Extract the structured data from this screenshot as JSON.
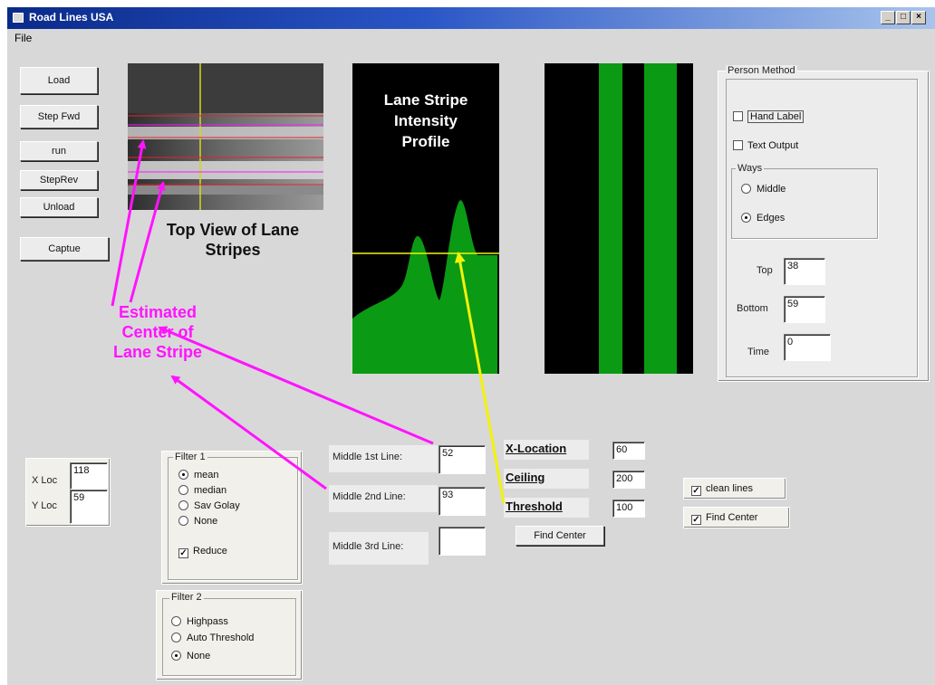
{
  "window": {
    "title": "Road Lines USA",
    "minimize": "_",
    "maximize": "□",
    "close": "×"
  },
  "menu": {
    "file": "File"
  },
  "buttons": {
    "load": "Load",
    "step_fwd": "Step Fwd",
    "run": "run",
    "step_rev": "StepRev",
    "unload": "Unload",
    "capture": "Captue",
    "find_center": "Find Center"
  },
  "panels": {
    "top_view_label": "Top View of Lane Stripes",
    "profile_title": [
      "Lane Stripe",
      "Intensity",
      "Profile"
    ]
  },
  "annotation": {
    "estimated_center": [
      "Estimated",
      "Center of",
      "Lane Stripe"
    ]
  },
  "person_method": {
    "legend": "Person Method",
    "hand_label": "Hand Label",
    "hand_label_checked": false,
    "text_output": "Text Output",
    "text_output_checked": false,
    "ways_legend": "Ways",
    "middle": "Middle",
    "edges": "Edges",
    "ways_selected": "edges",
    "top_label": "Top",
    "top_value": "38",
    "bottom_label": "Bottom",
    "bottom_value": "59",
    "time_label": "Time",
    "time_value": "0"
  },
  "loc": {
    "x_label": "X Loc",
    "x_value": "118",
    "y_label": "Y Loc",
    "y_value": "59"
  },
  "filter1": {
    "legend": "Filter 1",
    "options": [
      "mean",
      "median",
      "Sav Golay",
      "None"
    ],
    "selected": 0,
    "reduce": "Reduce",
    "reduce_checked": true
  },
  "filter2": {
    "legend": "Filter 2",
    "options": [
      "Highpass",
      "Auto Threshold",
      "None"
    ],
    "selected": 2
  },
  "middles": {
    "line1_label": "Middle 1st Line:",
    "line1_value": "52",
    "line2_label": "Middle 2nd Line:",
    "line2_value": "93",
    "line3_label": "Middle 3rd Line:",
    "line3_value": ""
  },
  "params": {
    "xloc_label": "X-Location",
    "xloc_value": "60",
    "ceiling_label": "Ceiling",
    "ceiling_value": "200",
    "threshold_label": "Threshold",
    "threshold_value": "100"
  },
  "options": {
    "clean_lines": "clean lines",
    "clean_lines_checked": true,
    "find_center": "Find Center",
    "find_center_checked": true
  },
  "colors": {
    "annotation_magenta": "#ff14ff",
    "threshold_yellow": "#f2f20a",
    "stripe_green": "#0b9a14",
    "road_red": "#e3232b"
  }
}
